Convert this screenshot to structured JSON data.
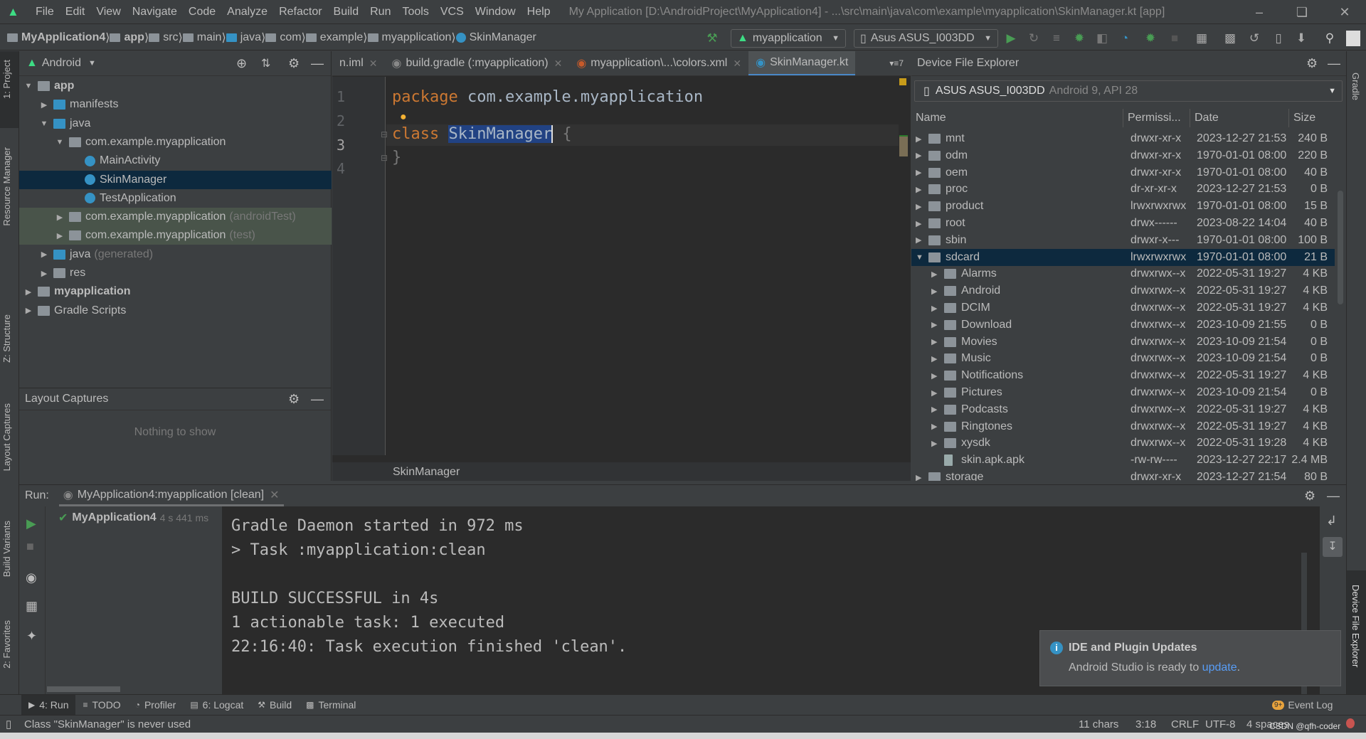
{
  "menubar": {
    "items": [
      "File",
      "Edit",
      "View",
      "Navigate",
      "Code",
      "Analyze",
      "Refactor",
      "Build",
      "Run",
      "Tools",
      "VCS",
      "Window",
      "Help"
    ],
    "window_title": "My Application [D:\\AndroidProject\\MyApplication4] - ...\\src\\main\\java\\com\\example\\myapplication\\SkinManager.kt [app]"
  },
  "navbar": {
    "breadcrumbs": [
      "MyApplication4",
      "app",
      "src",
      "main",
      "java",
      "com",
      "example",
      "myapplication",
      "SkinManager"
    ],
    "run_config": "myapplication",
    "device": "Asus ASUS_I003DD"
  },
  "left_stripe": {
    "tabs": [
      "1: Project",
      "Resource Manager",
      "Z: Structure",
      "Layout Captures",
      "Build Variants",
      "2: Favorites"
    ]
  },
  "right_stripe": {
    "tabs": [
      "Gradle",
      "Device File Explorer"
    ]
  },
  "project": {
    "view_selector": "Android",
    "tree": [
      {
        "label": "app",
        "level": 0,
        "arrow": "down",
        "bold": true,
        "icon": "module"
      },
      {
        "label": "manifests",
        "level": 1,
        "arrow": "right",
        "icon": "folder-blue"
      },
      {
        "label": "java",
        "level": 1,
        "arrow": "down",
        "icon": "folder-blue"
      },
      {
        "label": "com.example.myapplication",
        "level": 2,
        "arrow": "down",
        "icon": "package"
      },
      {
        "label": "MainActivity",
        "level": 3,
        "arrow": "",
        "icon": "kotlin-class"
      },
      {
        "label": "SkinManager",
        "level": 3,
        "arrow": "",
        "icon": "kotlin-class",
        "selected": true
      },
      {
        "label": "TestApplication",
        "level": 3,
        "arrow": "",
        "icon": "kotlin-class"
      },
      {
        "label": "com.example.myapplication",
        "suffix": "(androidTest)",
        "level": 2,
        "arrow": "right",
        "icon": "package",
        "test": true
      },
      {
        "label": "com.example.myapplication",
        "suffix": "(test)",
        "level": 2,
        "arrow": "right",
        "icon": "package",
        "test": true
      },
      {
        "label": "java",
        "suffix": "(generated)",
        "level": 1,
        "arrow": "right",
        "icon": "folder-generated"
      },
      {
        "label": "res",
        "level": 1,
        "arrow": "right",
        "icon": "folder-res"
      },
      {
        "label": "myapplication",
        "level": 0,
        "arrow": "right",
        "bold": true,
        "icon": "module"
      },
      {
        "label": "Gradle Scripts",
        "level": 0,
        "arrow": "right",
        "icon": "gradle"
      }
    ]
  },
  "layout_captures": {
    "title": "Layout Captures",
    "empty_text": "Nothing to show"
  },
  "editor": {
    "tabs": [
      {
        "label": "n.iml",
        "active": false
      },
      {
        "label": "build.gradle (:myapplication)",
        "active": false
      },
      {
        "label": "myapplication\\...\\colors.xml",
        "active": false
      },
      {
        "label": "SkinManager.kt",
        "active": true
      }
    ],
    "tab_overflow": "7",
    "lines": [
      "1",
      "2",
      "3",
      "4"
    ],
    "code": {
      "l1_kw": "package",
      "l1_rest": " com.example.myapplication",
      "l3_kw": "class",
      "l3_name": "SkinManager",
      "l3_rest": " {",
      "l4": "}"
    },
    "breadcrumb": "SkinManager"
  },
  "device_explorer": {
    "title": "Device File Explorer",
    "device": "ASUS ASUS_I003DD",
    "device_detail": "Android 9, API 28",
    "columns": [
      "Name",
      "Permissi...",
      "Date",
      "Size"
    ],
    "rows": [
      {
        "name": "mnt",
        "perm": "drwxr-xr-x",
        "date": "2023-12-27 21:53",
        "size": "240 B",
        "level": 0,
        "arrow": "right"
      },
      {
        "name": "odm",
        "perm": "drwxr-xr-x",
        "date": "1970-01-01 08:00",
        "size": "220 B",
        "level": 0,
        "arrow": "right"
      },
      {
        "name": "oem",
        "perm": "drwxr-xr-x",
        "date": "1970-01-01 08:00",
        "size": "40 B",
        "level": 0,
        "arrow": "right"
      },
      {
        "name": "proc",
        "perm": "dr-xr-xr-x",
        "date": "2023-12-27 21:53",
        "size": "0 B",
        "level": 0,
        "arrow": "right"
      },
      {
        "name": "product",
        "perm": "lrwxrwxrwx",
        "date": "1970-01-01 08:00",
        "size": "15 B",
        "level": 0,
        "arrow": "right",
        "link": true
      },
      {
        "name": "root",
        "perm": "drwx------",
        "date": "2023-08-22 14:04",
        "size": "40 B",
        "level": 0,
        "arrow": "right"
      },
      {
        "name": "sbin",
        "perm": "drwxr-x---",
        "date": "1970-01-01 08:00",
        "size": "100 B",
        "level": 0,
        "arrow": "right"
      },
      {
        "name": "sdcard",
        "perm": "lrwxrwxrwx",
        "date": "1970-01-01 08:00",
        "size": "21 B",
        "level": 0,
        "arrow": "down",
        "link": true,
        "selected": true
      },
      {
        "name": "Alarms",
        "perm": "drwxrwx--x",
        "date": "2022-05-31 19:27",
        "size": "4 KB",
        "level": 1,
        "arrow": "right"
      },
      {
        "name": "Android",
        "perm": "drwxrwx--x",
        "date": "2022-05-31 19:27",
        "size": "4 KB",
        "level": 1,
        "arrow": "right"
      },
      {
        "name": "DCIM",
        "perm": "drwxrwx--x",
        "date": "2022-05-31 19:27",
        "size": "4 KB",
        "level": 1,
        "arrow": "right"
      },
      {
        "name": "Download",
        "perm": "drwxrwx--x",
        "date": "2023-10-09 21:55",
        "size": "0 B",
        "level": 1,
        "arrow": "right"
      },
      {
        "name": "Movies",
        "perm": "drwxrwx--x",
        "date": "2023-10-09 21:54",
        "size": "0 B",
        "level": 1,
        "arrow": "right"
      },
      {
        "name": "Music",
        "perm": "drwxrwx--x",
        "date": "2023-10-09 21:54",
        "size": "0 B",
        "level": 1,
        "arrow": "right"
      },
      {
        "name": "Notifications",
        "perm": "drwxrwx--x",
        "date": "2022-05-31 19:27",
        "size": "4 KB",
        "level": 1,
        "arrow": "right"
      },
      {
        "name": "Pictures",
        "perm": "drwxrwx--x",
        "date": "2023-10-09 21:54",
        "size": "0 B",
        "level": 1,
        "arrow": "right"
      },
      {
        "name": "Podcasts",
        "perm": "drwxrwx--x",
        "date": "2022-05-31 19:27",
        "size": "4 KB",
        "level": 1,
        "arrow": "right"
      },
      {
        "name": "Ringtones",
        "perm": "drwxrwx--x",
        "date": "2022-05-31 19:27",
        "size": "4 KB",
        "level": 1,
        "arrow": "right"
      },
      {
        "name": "xysdk",
        "perm": "drwxrwx--x",
        "date": "2022-05-31 19:28",
        "size": "4 KB",
        "level": 1,
        "arrow": "right"
      },
      {
        "name": "skin.apk.apk",
        "perm": "-rw-rw----",
        "date": "2023-12-27 22:17",
        "size": "2.4 MB",
        "level": 1,
        "arrow": "",
        "file": true
      },
      {
        "name": "storage",
        "perm": "drwxr-xr-x",
        "date": "2023-12-27 21:54",
        "size": "80 B",
        "level": 0,
        "arrow": "right"
      }
    ]
  },
  "run": {
    "label": "Run:",
    "tab": "MyApplication4:myapplication [clean]",
    "tree_item": "MyApplication4",
    "tree_time": "4 s 441 ms",
    "console": [
      "Gradle Daemon started in 972 ms",
      "> Task :myapplication:clean",
      "",
      "BUILD SUCCESSFUL in 4s",
      "1 actionable task: 1 executed",
      "22:16:40: Task execution finished 'clean'."
    ]
  },
  "notification": {
    "title": "IDE and Plugin Updates",
    "text": "Android Studio is ready to ",
    "link": "update",
    "tail": "."
  },
  "bottom_tools": [
    {
      "label": "4: Run",
      "icon": "play-icon"
    },
    {
      "label": "TODO",
      "icon": "list-icon"
    },
    {
      "label": "Profiler",
      "icon": "gauge-icon"
    },
    {
      "label": "6: Logcat",
      "icon": "logcat-icon"
    },
    {
      "label": "Build",
      "icon": "hammer-icon"
    },
    {
      "label": "Terminal",
      "icon": "terminal-icon"
    }
  ],
  "event_log": {
    "label": "Event Log",
    "badge": "9+"
  },
  "statusbar": {
    "message": "Class \"SkinManager\" is never used",
    "chars": "11 chars",
    "position": "3:18",
    "line_sep": "CRLF",
    "encoding": "UTF-8",
    "indent": "4 spaces",
    "watermark": "CSDN @qfh-coder"
  },
  "colors": {
    "accent": "#4a88c7",
    "keyword": "#cc7832",
    "selection": "#214283",
    "android_green": "#3ddc84",
    "link": "#589df6",
    "run_green": "#499c54"
  }
}
